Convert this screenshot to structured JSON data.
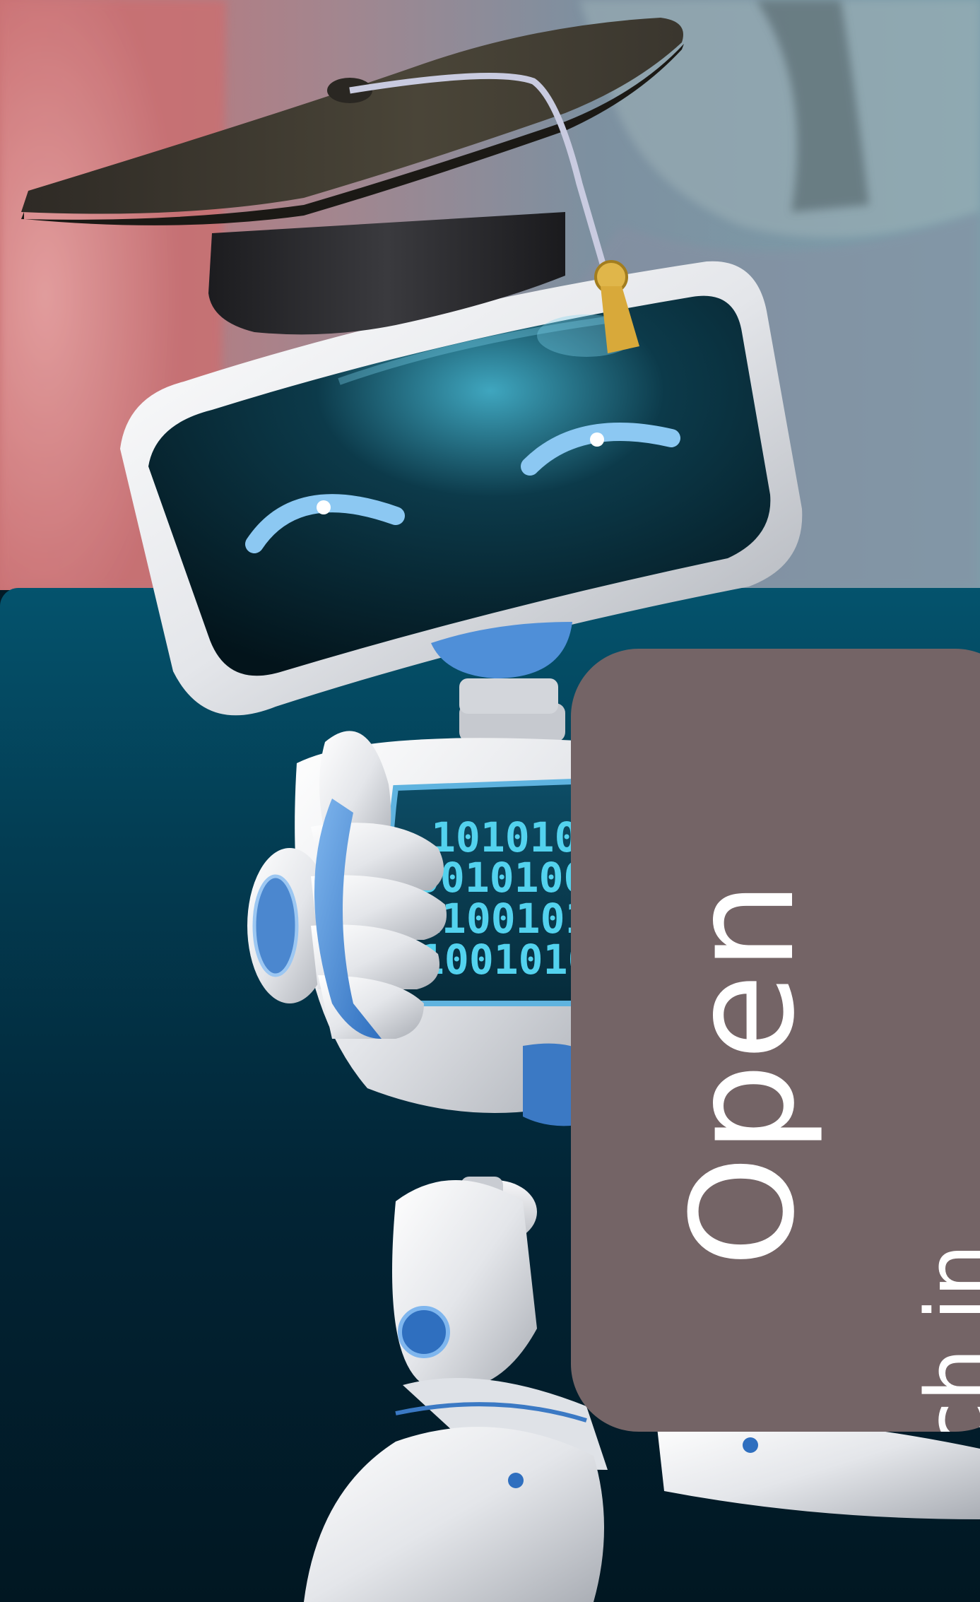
{
  "card": {
    "title": "Open",
    "side_text": "Tech in"
  },
  "icons": {
    "robot": "graduate-robot-mascot",
    "cap": "graduation-cap-icon"
  },
  "colors": {
    "panel_top": "#04536d",
    "panel_bottom": "#011722",
    "card_bg": "#746466",
    "robot_screen": "#06222d",
    "robot_eyes": "#7fc6f0",
    "cap": "#2b2824",
    "tassel": "#d2a83a"
  }
}
